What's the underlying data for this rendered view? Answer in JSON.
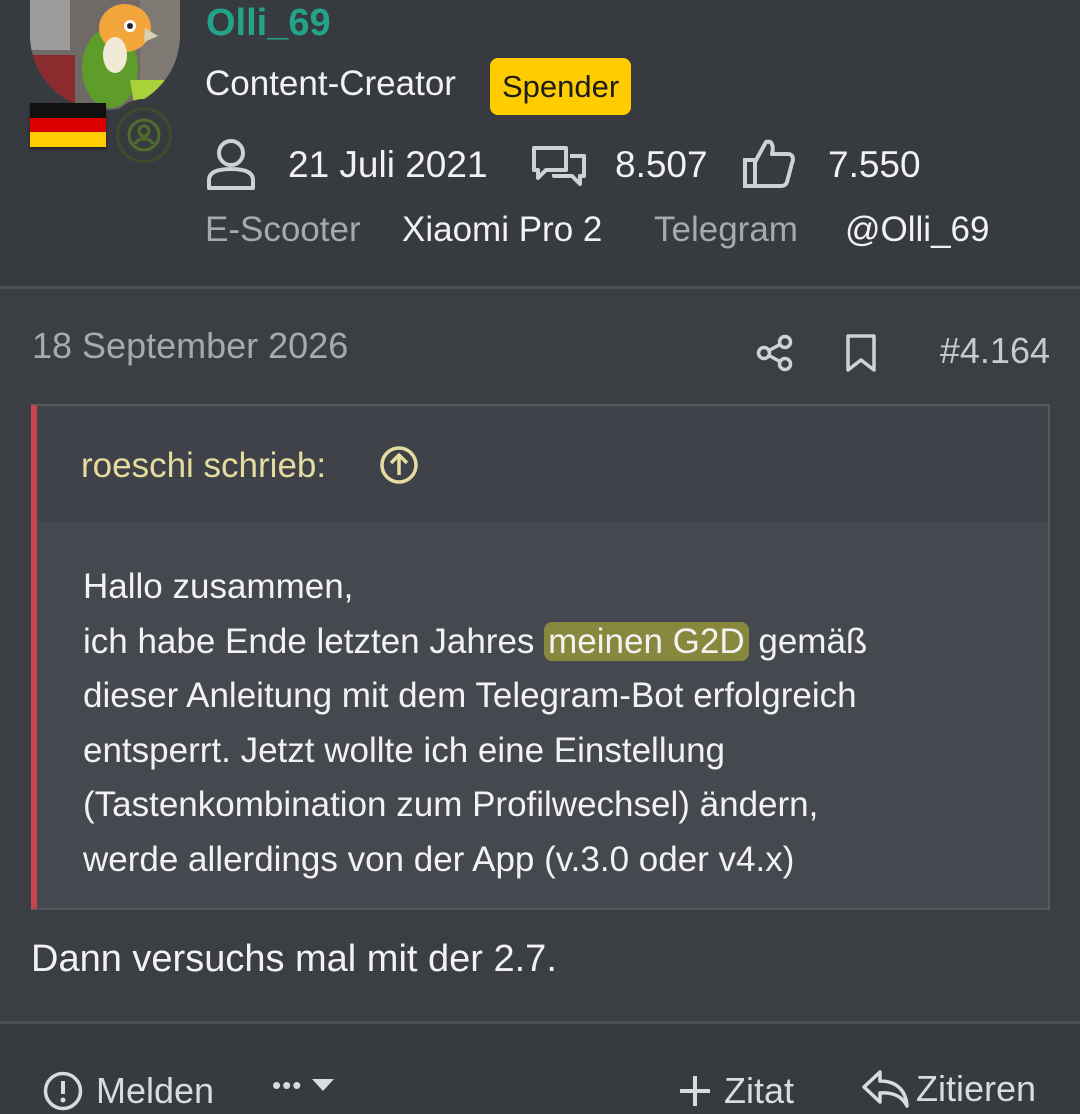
{
  "user": {
    "username": "Olli_69",
    "role": "Content-Creator",
    "badge": "Spender",
    "joined": "21 Juli 2021",
    "messages": "8.507",
    "reactions": "7.550",
    "fields": [
      {
        "label": "E-Scooter",
        "value": "Xiaomi Pro 2"
      },
      {
        "label": "Telegram",
        "value": "@Olli_69"
      }
    ]
  },
  "icons": {
    "member_since": "user-icon",
    "messages": "chat-bubbles-icon",
    "reactions": "thumbs-up-icon",
    "share": "share-icon",
    "bookmark": "bookmark-icon",
    "quote_up": "arrow-up-circle-icon",
    "report": "exclamation-circle-icon",
    "more": "ellipsis-icon",
    "zitat": "plus-icon",
    "reply": "reply-arrow-icon"
  },
  "post": {
    "date": "18 September 2026",
    "number": "#4.164",
    "quote_author": "roeschi schrieb:",
    "quote_lines": [
      "Hallo zusammen,",
      "ich habe Ende letzten Jahres",
      "meinen G2D",
      "gemäß",
      "dieser Anleitung mit dem Telegram-Bot erfolgreich",
      "entsperrt. Jetzt wollte ich eine Einstellung",
      "(Tastenkombination zum Profilwechsel) ändern,",
      "werde allerdings von der App (v.3.0 oder v4.x)"
    ],
    "reply_text": "Dann versuchs mal mit der 2.7."
  },
  "actions": {
    "report": "Melden",
    "more": "•••",
    "zitat": "Zitat",
    "zitieren": "Zitieren"
  },
  "colors": {
    "background": "#373a3f",
    "username": "#22a38a",
    "badge": "#ffcc00",
    "quote_border": "#c8454b",
    "quote_author": "#e6dca0",
    "highlight": "#bebe32"
  }
}
